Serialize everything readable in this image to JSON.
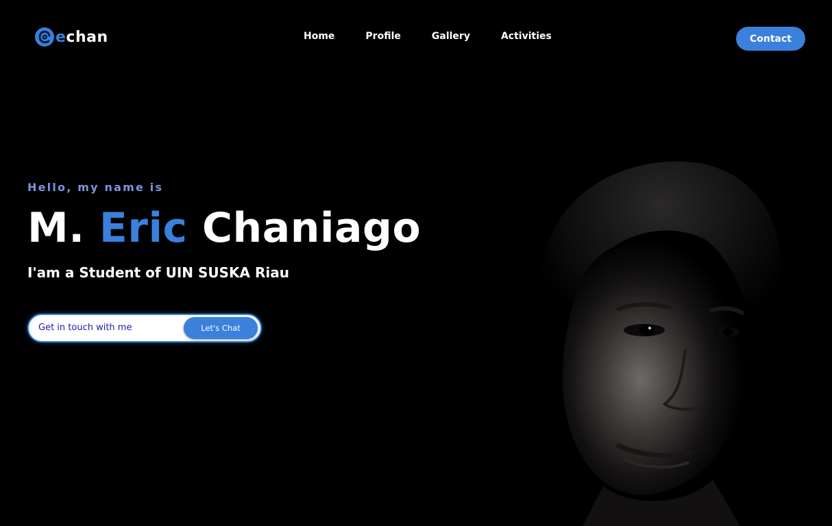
{
  "brand": {
    "logo_accent": "e",
    "logo_rest": "chan",
    "logo_icon": "swirl-icon"
  },
  "nav": {
    "items": [
      {
        "label": "Home"
      },
      {
        "label": "Profile"
      },
      {
        "label": "Gallery"
      },
      {
        "label": "Activities"
      }
    ],
    "contact_label": "Contact"
  },
  "hero": {
    "greeting": "Hello, my name is",
    "name_first": "M.",
    "name_middle": "Eric",
    "name_last": "Chaniago",
    "subtitle": "I'am a Student of UIN SUSKA Riau",
    "cta_text": "Get in touch with me",
    "cta_button": "Let's Chat"
  },
  "colors": {
    "background": "#000000",
    "accent": "#3a80dc",
    "greeting": "#7e94df",
    "cta_text": "#1c1ca8"
  }
}
